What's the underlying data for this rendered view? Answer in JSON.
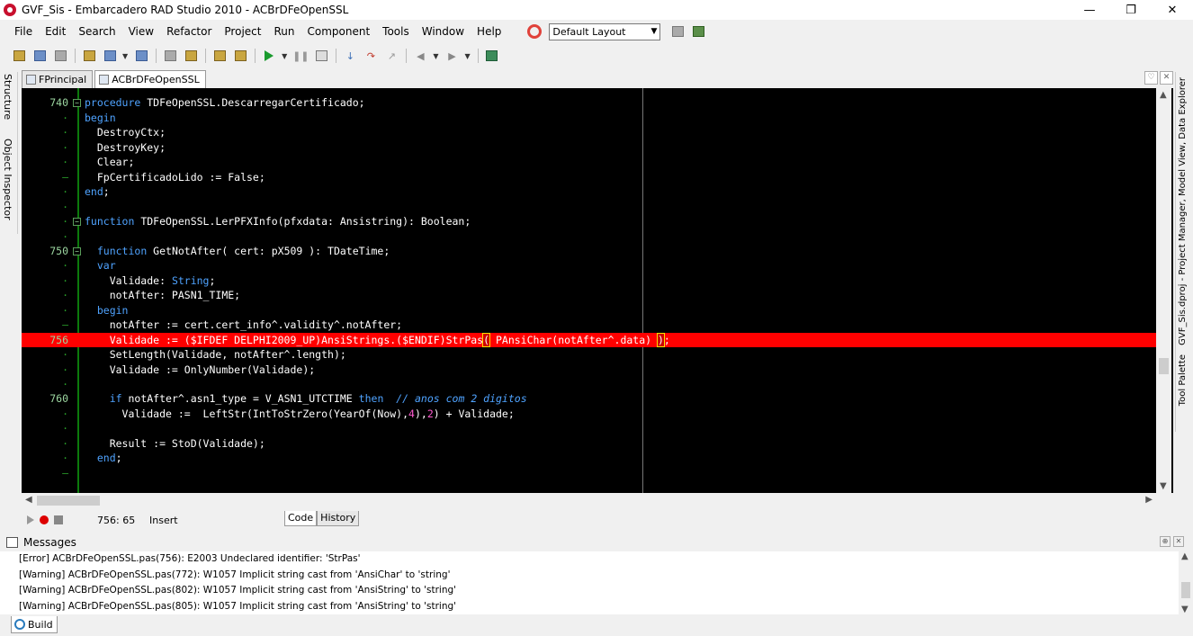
{
  "window": {
    "title": "GVF_Sis - Embarcadero RAD Studio 2010 - ACBrDFeOpenSSL",
    "minimize": "—",
    "maximize": "❐",
    "close": "✕"
  },
  "menu": {
    "items": [
      "File",
      "Edit",
      "Search",
      "View",
      "Refactor",
      "Project",
      "Run",
      "Component",
      "Tools",
      "Window",
      "Help"
    ],
    "layout_selector": "Default Layout"
  },
  "left_dock": {
    "structure": "Structure",
    "object_inspector": "Object Inspector"
  },
  "right_dock": {
    "project_manager": "GVF_Sis.dproj - Project Manager, Model View, Data Explorer",
    "tool_palette": "Tool Palette"
  },
  "editor_tabs": [
    {
      "label": "FPrincipal"
    },
    {
      "label": "ACBrDFeOpenSSL"
    }
  ],
  "code_lines": [
    {
      "num": "",
      "text": ""
    },
    {
      "num": "740",
      "fold": "⊟",
      "html": "<span class=\"kw\">procedure</span> TDFeOpenSSL.DescarregarCertificado;"
    },
    {
      "num": "·",
      "html": "<span class=\"kw\">begin</span>"
    },
    {
      "num": "·",
      "html": "  DestroyCtx;"
    },
    {
      "num": "·",
      "html": "  DestroyKey;"
    },
    {
      "num": "·",
      "html": "  Clear;"
    },
    {
      "num": "–",
      "html": "  FpCertificadoLido := False;"
    },
    {
      "num": "·",
      "html": "<span class=\"kw\">end</span>;"
    },
    {
      "num": "·",
      "html": ""
    },
    {
      "num": "·",
      "fold": "⊟",
      "html": "<span class=\"kw\">function</span> TDFeOpenSSL.LerPFXInfo(pfxdata: Ansistring): Boolean;"
    },
    {
      "num": "·",
      "html": ""
    },
    {
      "num": "750",
      "fold": "⊟",
      "html": "  <span class=\"kw\">function</span> GetNotAfter( cert: pX509 ): TDateTime;"
    },
    {
      "num": "·",
      "html": "  <span class=\"kw\">var</span>"
    },
    {
      "num": "·",
      "html": "    Validade: <span class=\"kw\">String</span>;"
    },
    {
      "num": "·",
      "html": "    notAfter: PASN1_TIME;"
    },
    {
      "num": "·",
      "html": "  <span class=\"kw\">begin</span>"
    },
    {
      "num": "–",
      "html": "    notAfter := cert.cert_info^.validity^.notAfter;"
    },
    {
      "num": "756",
      "error": true,
      "html": "    Validade := ($IFDEF DELPHI2009_UP)AnsiStrings.($ENDIF)StrPas<span class=\"bracket\">(</span> PAnsiChar(notAfter^.data) <span class=\"bracket\">)</span>;"
    },
    {
      "num": "·",
      "html": "    SetLength(Validade, notAfter^.length);"
    },
    {
      "num": "·",
      "html": "    Validade := OnlyNumber(Validade);"
    },
    {
      "num": "·",
      "html": ""
    },
    {
      "num": "760",
      "html": "    <span class=\"kw\">if</span> notAfter^.asn1_type = V_ASN1_UTCTIME <span class=\"kw\">then</span>  <span class=\"cmt\">// anos com 2 digitos</span>"
    },
    {
      "num": "·",
      "html": "      Validade :=  LeftStr(IntToStrZero(YearOf(Now),<span class=\"num\">4</span>),<span class=\"num\">2</span>) + Validade;"
    },
    {
      "num": "·",
      "html": ""
    },
    {
      "num": "·",
      "html": "    Result := StoD(Validade);"
    },
    {
      "num": "·",
      "html": "  <span class=\"kw\">end</span>;"
    },
    {
      "num": "–",
      "html": ""
    }
  ],
  "status": {
    "position": "756: 65",
    "mode": "Insert",
    "tab_code": "Code",
    "tab_history": "History"
  },
  "messages": {
    "title": "Messages",
    "items": [
      "[Error] ACBrDFeOpenSSL.pas(756): E2003 Undeclared identifier: 'StrPas'",
      "[Warning] ACBrDFeOpenSSL.pas(772): W1057 Implicit string cast from 'AnsiChar' to 'string'",
      "[Warning] ACBrDFeOpenSSL.pas(802): W1057 Implicit string cast from 'AnsiString' to 'string'",
      "[Warning] ACBrDFeOpenSSL.pas(805): W1057 Implicit string cast from 'AnsiString' to 'string'"
    ],
    "build_tab": "Build"
  },
  "colors": {
    "editor_bg": "#000000",
    "keyword": "#4fa3ff",
    "error_line": "#ff0000",
    "gutter_bar": "#0c7a0c"
  }
}
